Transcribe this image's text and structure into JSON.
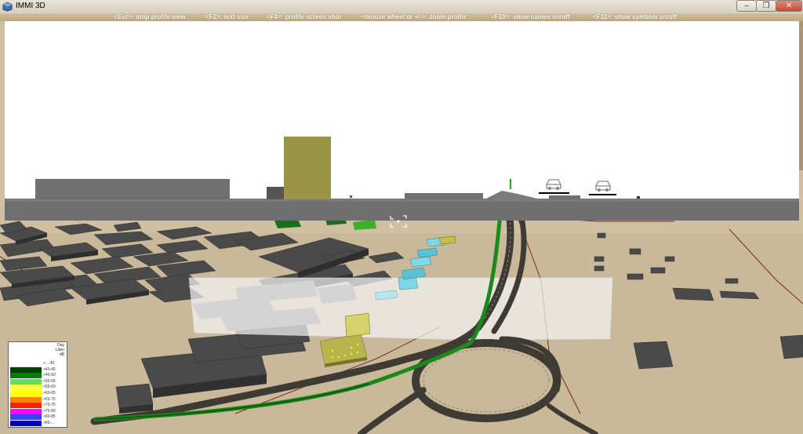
{
  "window": {
    "title": "IMMI 3D"
  },
  "window_controls": {
    "minimize": "‒",
    "maximize": "❐",
    "close": "✕"
  },
  "hints": [
    "<Esc>: stop profile view",
    "<F2>: text size",
    "<F4>: profile screen shot",
    "<mouse wheel or +/->: zoom profile",
    "<F10>: show names on/off",
    "<F11>: show symbols on/off"
  ],
  "legend": {
    "header": [
      "Day",
      "Lden",
      "dB"
    ],
    "items": [
      {
        "label": ">...-40",
        "color": "#ffffff"
      },
      {
        "label": ">40-45",
        "color": "#004000"
      },
      {
        "label": ">45-50",
        "color": "#008000"
      },
      {
        "label": ">50-55",
        "color": "#60e060"
      },
      {
        "label": ">55-60",
        "color": "#ffff40"
      },
      {
        "label": ">60-65",
        "color": "#ffff00"
      },
      {
        "label": ">65-70",
        "color": "#ff8000"
      },
      {
        "label": ">70-75",
        "color": "#ff2000"
      },
      {
        "label": ">75-80",
        "color": "#ff00ff"
      },
      {
        "label": ">80-85",
        "color": "#4040ff"
      },
      {
        "label": ">85-...",
        "color": "#0000c0"
      }
    ]
  },
  "colors": {
    "profile_bg": "#ffffff",
    "profile_ground": "#6e6e6e",
    "profile_building": "#9b9444",
    "terrain": "#c9b89a",
    "buildings": "#4a4a4a",
    "road": "#3d3b33",
    "green_barrier": "#1a8a1a"
  }
}
